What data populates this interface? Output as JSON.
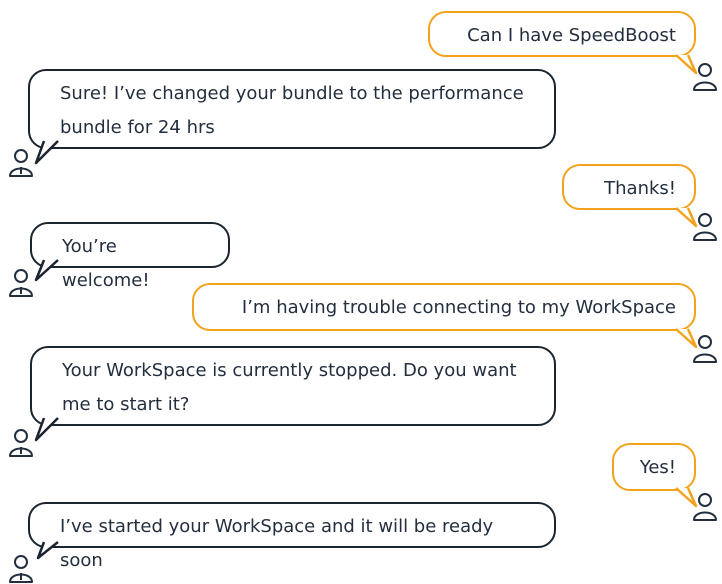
{
  "conversation": {
    "messages": [
      {
        "sender": "user",
        "text": "Can I have SpeedBoost"
      },
      {
        "sender": "bot",
        "text": "Sure! I’ve changed your bundle to the performance bundle for 24 hrs"
      },
      {
        "sender": "user",
        "text": "Thanks!"
      },
      {
        "sender": "bot",
        "text": "You’re welcome!"
      },
      {
        "sender": "user",
        "text": "I’m having trouble connecting to my WorkSpace"
      },
      {
        "sender": "bot",
        "text": "Your WorkSpace is currently stopped. Do you want me to start it?"
      },
      {
        "sender": "user",
        "text": "Yes!"
      },
      {
        "sender": "bot",
        "text": "I’ve started your WorkSpace and it will be ready soon"
      }
    ]
  },
  "colors": {
    "user_bubble_border": "#f3a21b",
    "bot_bubble_border": "#1b2530",
    "text": "#232f3e",
    "avatar_stroke": "#232f3e"
  },
  "icons": {
    "user": "user-avatar-icon",
    "bot": "agent-avatar-icon"
  }
}
